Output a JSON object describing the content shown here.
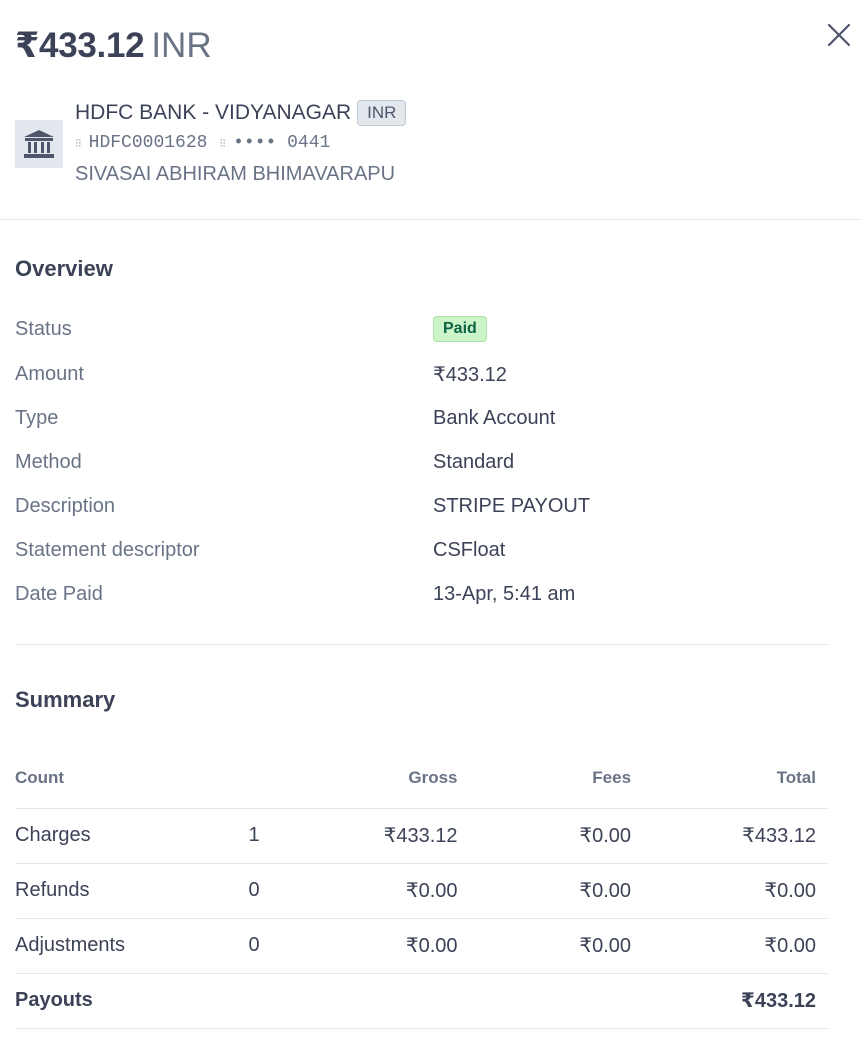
{
  "header": {
    "amount": "₹433.12",
    "currency": "INR"
  },
  "bank": {
    "name": "HDFC BANK - VIDYANAGAR",
    "currency_badge": "INR",
    "ifsc": "HDFC0001628",
    "masked_account": "•••• 0441",
    "holder": "SIVASAI ABHIRAM BHIMAVARAPU"
  },
  "overview": {
    "title": "Overview",
    "rows": [
      {
        "label": "Status",
        "value": "Paid"
      },
      {
        "label": "Amount",
        "value": "₹433.12"
      },
      {
        "label": "Type",
        "value": "Bank Account"
      },
      {
        "label": "Method",
        "value": "Standard"
      },
      {
        "label": "Description",
        "value": "STRIPE PAYOUT"
      },
      {
        "label": "Statement descriptor",
        "value": "CSFloat"
      },
      {
        "label": "Date Paid",
        "value": "13-Apr, 5:41 am"
      }
    ]
  },
  "summary": {
    "title": "Summary",
    "columns": {
      "count": "Count",
      "gross": "Gross",
      "fees": "Fees",
      "total": "Total"
    },
    "rows": [
      {
        "label": "Charges",
        "count": "1",
        "gross": "₹433.12",
        "fees": "₹0.00",
        "total": "₹433.12"
      },
      {
        "label": "Refunds",
        "count": "0",
        "gross": "₹0.00",
        "fees": "₹0.00",
        "total": "₹0.00"
      },
      {
        "label": "Adjustments",
        "count": "0",
        "gross": "₹0.00",
        "fees": "₹0.00",
        "total": "₹0.00"
      }
    ],
    "payouts": {
      "label": "Payouts",
      "total": "₹433.12"
    }
  },
  "colors": {
    "paid_badge_bg": "#cbf4c9",
    "paid_badge_text": "#0e6245",
    "text_primary": "#3c4257",
    "text_secondary": "#697386"
  },
  "icons": {
    "close": "close-icon",
    "bank": "bank-icon",
    "separator": "separator-dots-icon"
  }
}
